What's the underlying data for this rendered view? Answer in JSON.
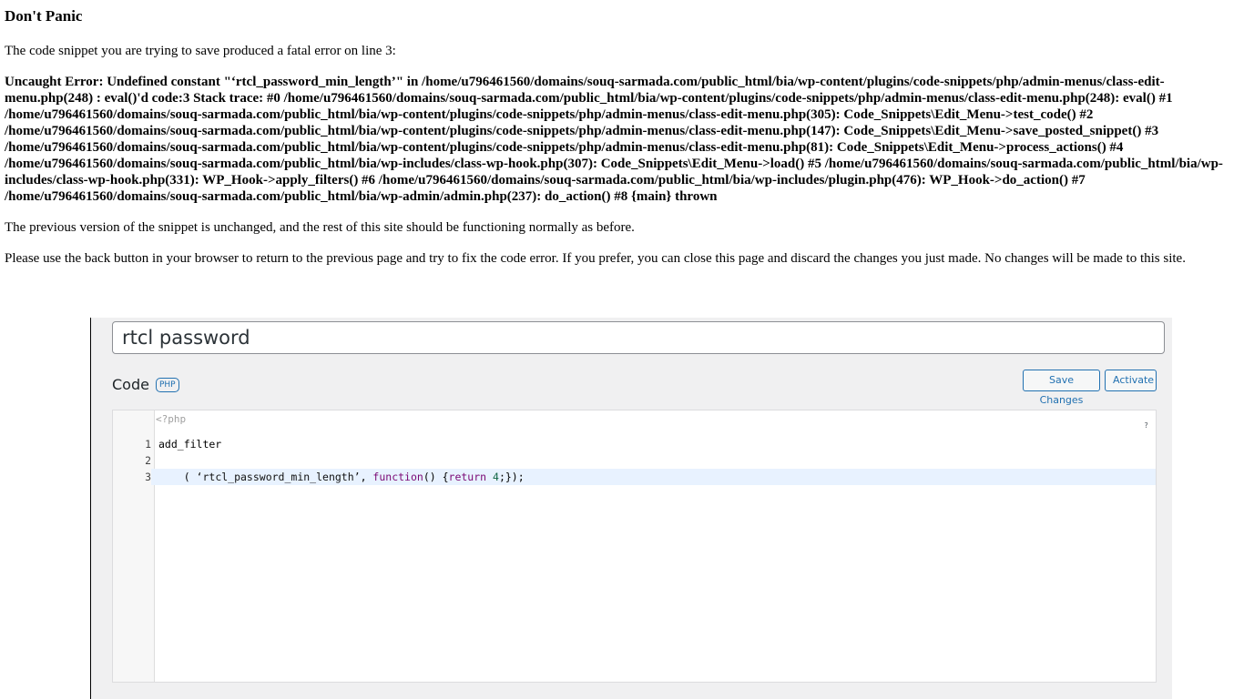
{
  "error_page": {
    "title": "Don't Panic",
    "intro": "The code snippet you are trying to save produced a fatal error on line 3:",
    "error_message": "Uncaught Error: Undefined constant \"‘rtcl_password_min_length’\" in /home/u796461560/domains/souq-sarmada.com/public_html/bia/wp-content/plugins/code-snippets/php/admin-menus/class-edit-menu.php(248) : eval()'d code:3 Stack trace: #0 /home/u796461560/domains/souq-sarmada.com/public_html/bia/wp-content/plugins/code-snippets/php/admin-menus/class-edit-menu.php(248): eval() #1 /home/u796461560/domains/souq-sarmada.com/public_html/bia/wp-content/plugins/code-snippets/php/admin-menus/class-edit-menu.php(305): Code_Snippets\\Edit_Menu->test_code() #2 /home/u796461560/domains/souq-sarmada.com/public_html/bia/wp-content/plugins/code-snippets/php/admin-menus/class-edit-menu.php(147): Code_Snippets\\Edit_Menu->save_posted_snippet() #3 /home/u796461560/domains/souq-sarmada.com/public_html/bia/wp-content/plugins/code-snippets/php/admin-menus/class-edit-menu.php(81): Code_Snippets\\Edit_Menu->process_actions() #4 /home/u796461560/domains/souq-sarmada.com/public_html/bia/wp-includes/class-wp-hook.php(307): Code_Snippets\\Edit_Menu->load() #5 /home/u796461560/domains/souq-sarmada.com/public_html/bia/wp-includes/class-wp-hook.php(331): WP_Hook->apply_filters() #6 /home/u796461560/domains/souq-sarmada.com/public_html/bia/wp-includes/plugin.php(476): WP_Hook->do_action() #7 /home/u796461560/domains/souq-sarmada.com/public_html/bia/wp-admin/admin.php(237): do_action() #8 {main} thrown",
    "previous_version": "The previous version of the snippet is unchanged, and the rest of this site should be functioning normally as before.",
    "instructions": "Please use the back button in your browser to return to the previous page and try to fix the code error. If you prefer, you can close this page and discard the changes you just made. No changes will be made to this site."
  },
  "editor": {
    "snippet_title": "rtcl password",
    "code_heading": "Code",
    "language_badge": "PHP",
    "save_label": "Save Changes",
    "activate_label": "Activate",
    "php_open_tag": "<?php",
    "help_icon_text": "?",
    "lines": [
      {
        "number": "1",
        "code": "add_filter"
      },
      {
        "number": "2",
        "code": ""
      },
      {
        "number": "3",
        "prefix": "    ( ",
        "string": "‘rtcl_password_min_length’",
        "sep": ", ",
        "keyword": "function",
        "parens": "() {",
        "ret": "return",
        "space": " ",
        "num": "4",
        "suffix": ";});"
      }
    ]
  },
  "colors": {
    "accent": "#2271b1",
    "active_line": "#e8f2ff",
    "panel_bg": "#f0f0f1"
  }
}
